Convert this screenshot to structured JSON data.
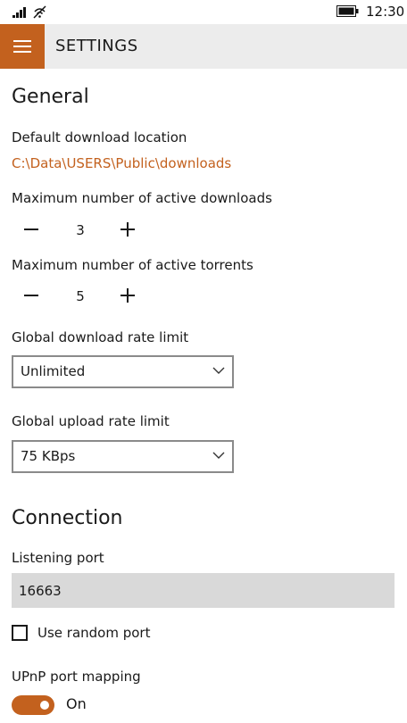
{
  "status_bar": {
    "time": "12:30",
    "icons": [
      "signal-icon",
      "wifi-icon",
      "battery-icon"
    ]
  },
  "app_bar": {
    "menu_icon": "hamburger-menu-icon",
    "title": "SETTINGS",
    "accent_color": "#c3611e"
  },
  "general": {
    "heading": "General",
    "download_location": {
      "label": "Default download location",
      "value": "C:\\Data\\USERS\\Public\\downloads"
    },
    "max_active_downloads": {
      "label": "Maximum number of active downloads",
      "value": "3"
    },
    "max_active_torrents": {
      "label": "Maximum number of active torrents",
      "value": "5"
    },
    "download_rate_limit": {
      "label": "Global download rate limit",
      "selected": "Unlimited"
    },
    "upload_rate_limit": {
      "label": "Global upload rate limit",
      "selected": "75 KBps"
    }
  },
  "connection": {
    "heading": "Connection",
    "listening_port": {
      "label": "Listening port",
      "value": "16663"
    },
    "random_port": {
      "label": "Use random port",
      "checked": false
    },
    "upnp": {
      "label": "UPnP port mapping",
      "state_label": "On",
      "enabled": true
    }
  }
}
